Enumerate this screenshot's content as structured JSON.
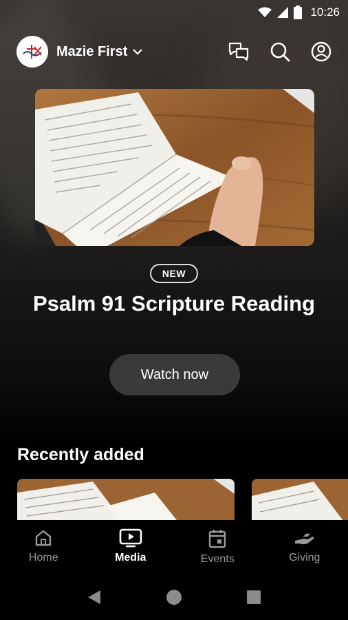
{
  "status_bar": {
    "time": "10:26"
  },
  "header": {
    "org_name": "Mazie First",
    "logo_icon": "church-cross-logo-icon",
    "actions": [
      "chat-icon",
      "search-icon",
      "account-icon"
    ]
  },
  "hero": {
    "badge": "NEW",
    "title": "Psalm 91 Scripture Reading",
    "button_label": "Watch now",
    "image": "open-bible-photo"
  },
  "recent": {
    "title": "Recently added",
    "items": [
      "open-bible-photo",
      "open-bible-photo"
    ]
  },
  "bottom_nav": {
    "items": [
      {
        "label": "Home",
        "icon": "home-icon",
        "active": false
      },
      {
        "label": "Media",
        "icon": "tv-play-icon",
        "active": true
      },
      {
        "label": "Events",
        "icon": "calendar-icon",
        "active": false
      },
      {
        "label": "Giving",
        "icon": "giving-hand-icon",
        "active": false
      }
    ]
  },
  "system_nav": [
    "back-icon",
    "home-circle-icon",
    "recents-square-icon"
  ],
  "colors": {
    "background": "#000000",
    "button": "#3a3a3a",
    "inactive": "#9a9a9a"
  }
}
